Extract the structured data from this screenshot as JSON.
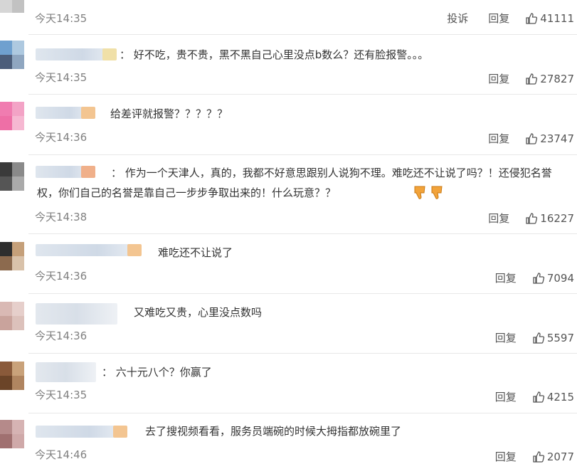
{
  "actions": {
    "report": "投诉",
    "reply": "回复"
  },
  "comments": [
    {
      "text": "",
      "time": "今天14:35",
      "likes": "41111",
      "has_report": true
    },
    {
      "text": "：  好不吃，贵不贵，黑不黑自己心里没点b数么？还有脸报警。。。",
      "time": "今天14:35",
      "likes": "27827"
    },
    {
      "text": "给差评就报警？？？？？",
      "time": "今天14:36",
      "likes": "23747"
    },
    {
      "text": "：  作为一个天津人，真的，我都不好意思跟别人说狗不理。难吃还不让说了吗？！还侵犯名誉权，你们自己的名誉是靠自己一步步争取出来的！什么玩意？？",
      "time": "今天14:38",
      "likes": "16227"
    },
    {
      "text": "难吃还不让说了",
      "time": "今天14:36",
      "likes": "7094"
    },
    {
      "text": "又难吃又贵，心里没点数吗",
      "time": "今天14:36",
      "likes": "5597"
    },
    {
      "text": "：  六十元八个？你赢了",
      "time": "今天14:35",
      "likes": "4215"
    },
    {
      "text": "去了搜视频看看，服务员端碗的时候大拇指都放碗里了",
      "time": "今天14:46",
      "likes": "2077"
    }
  ]
}
